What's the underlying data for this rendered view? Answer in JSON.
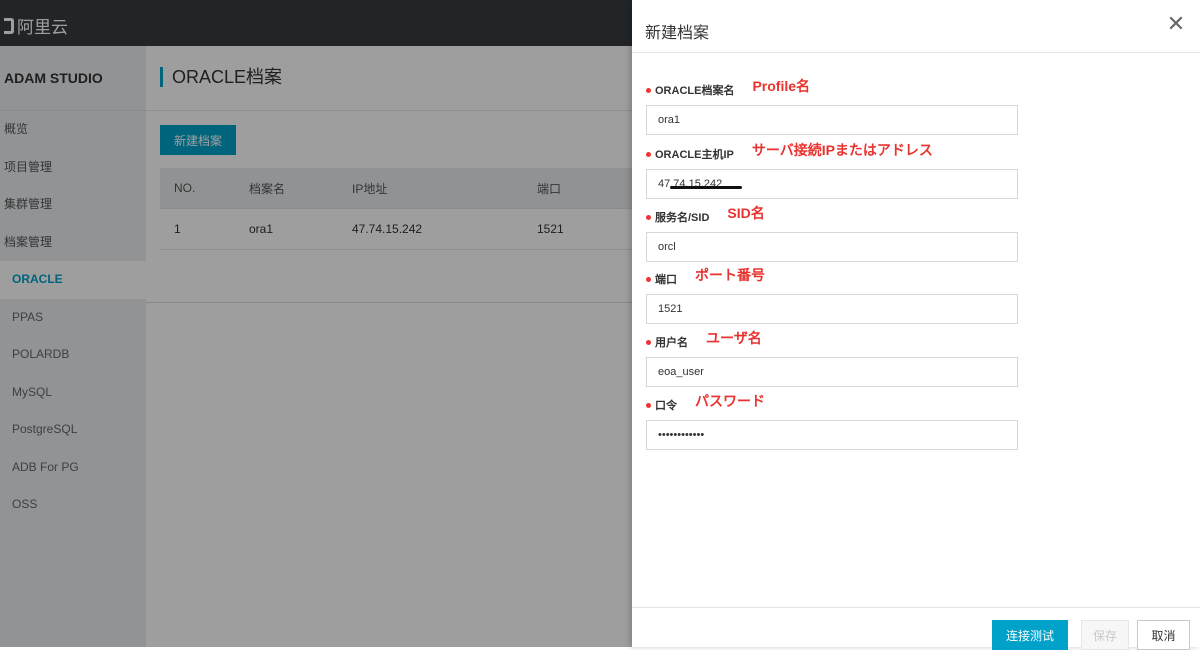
{
  "topbar": {
    "logo_text": "阿里云"
  },
  "sidebar": {
    "title": "ADAM STUDIO",
    "items": [
      {
        "label": "概览"
      },
      {
        "label": "项目管理"
      },
      {
        "label": "集群管理"
      },
      {
        "label": "档案管理"
      }
    ],
    "sub_items": [
      {
        "label": "ORACLE",
        "active": true
      },
      {
        "label": "PPAS"
      },
      {
        "label": "POLARDB"
      },
      {
        "label": "MySQL"
      },
      {
        "label": "PostgreSQL"
      },
      {
        "label": "ADB For PG"
      },
      {
        "label": "OSS"
      }
    ]
  },
  "main": {
    "title": "ORACLE档案",
    "new_button": "新建档案",
    "table": {
      "headers": [
        "NO.",
        "档案名",
        "IP地址",
        "端口"
      ],
      "rows": [
        [
          "1",
          "ora1",
          "47.74.15.242",
          "1521"
        ]
      ]
    }
  },
  "dialog": {
    "title": "新建档案",
    "fields": [
      {
        "label": "ORACLE档案名",
        "annotation": "Profile名",
        "value": "ora1"
      },
      {
        "label": "ORACLE主机IP",
        "annotation": "サーバ接続IPまたはアドレス",
        "value": "47.74.15.242"
      },
      {
        "label": "服务名/SID",
        "annotation": "SID名",
        "value": "orcl"
      },
      {
        "label": "端口",
        "annotation": "ポート番号",
        "value": "1521"
      },
      {
        "label": "用户名",
        "annotation": "ユーザ名",
        "value": "eoa_user"
      },
      {
        "label": "口令",
        "annotation": "パスワード",
        "value": "••••••••••••"
      }
    ],
    "footer": {
      "test_label": "连接测试",
      "save_label": "保存",
      "cancel_label": "取消"
    }
  },
  "colors": {
    "accent": "#00a2ca",
    "topbar": "#373d41",
    "sidebar": "#eaedf1",
    "required": "#e33333",
    "annotation": "#e8332e"
  }
}
